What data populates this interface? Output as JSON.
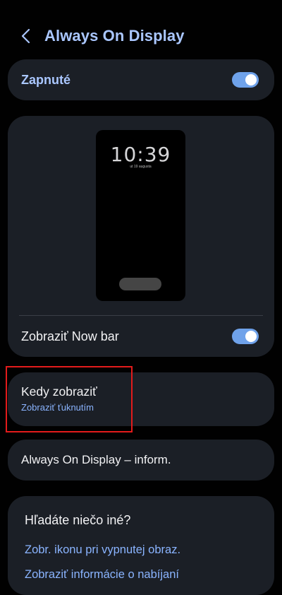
{
  "header": {
    "title": "Always On Display",
    "back_icon": "chevron-left-icon"
  },
  "main_toggle": {
    "label": "Zapnuté",
    "on": true
  },
  "preview": {
    "time": "10:39",
    "date": "ut 19 augusta",
    "nowbar_label": "Zobraziť Now bar",
    "nowbar_on": true
  },
  "when": {
    "title": "Kedy zobraziť",
    "value": "Zobraziť ťuknutím"
  },
  "info": {
    "label": "Always On Display – inform."
  },
  "looking": {
    "heading": "Hľadáte niečo iné?",
    "links": [
      "Zobr. ikonu pri vypnutej obraz.",
      "Zobraziť informácie o nabíjaní"
    ]
  },
  "colors": {
    "accent": "#aac7ff",
    "card": "#1b1f26",
    "switch_on": "#6fa2ea"
  }
}
